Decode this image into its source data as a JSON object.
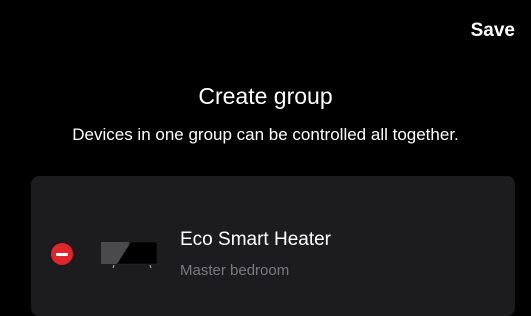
{
  "header": {
    "save_label": "Save"
  },
  "main": {
    "title": "Create group",
    "subtitle": "Devices in one group can be controlled all together."
  },
  "devices": [
    {
      "name": "Eco Smart Heater",
      "room": "Master bedroom",
      "icon": "heater-device-icon"
    }
  ],
  "colors": {
    "background": "#000000",
    "card": "#1c1c1e",
    "remove": "#e0252b",
    "secondary_text": "#7a7a7e"
  }
}
